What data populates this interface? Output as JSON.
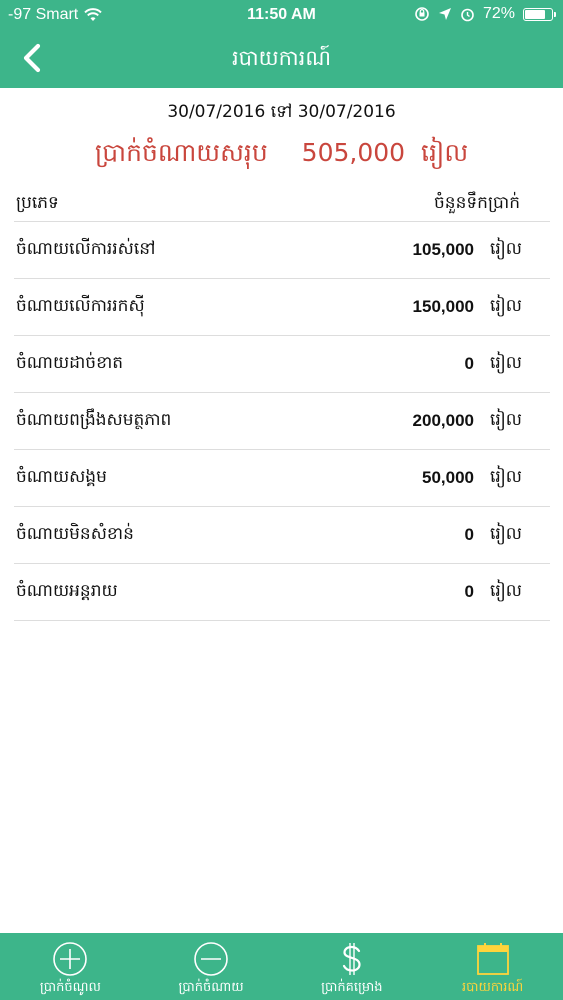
{
  "status_bar": {
    "carrier": "-97 Smart",
    "time": "11:50 AM",
    "battery": "72%",
    "battery_level": 0.72
  },
  "header": {
    "title": "របាយការណ៍"
  },
  "report": {
    "date_from": "30/07/2016",
    "date_separator": "ទៅ",
    "date_to": "30/07/2016",
    "total_label": "ប្រាក់ចំណាយសរុប",
    "total_amount": "505,000",
    "currency": "រៀល"
  },
  "table": {
    "col_category": "ប្រភេទ",
    "col_amount": "ចំនួនទឹកប្រាក់",
    "rows": [
      {
        "name": "ចំណាយលើការរស់នៅ",
        "amount": "105,000",
        "unit": "រៀល"
      },
      {
        "name": "ចំណាយលើការរកស៊ី",
        "amount": "150,000",
        "unit": "រៀល"
      },
      {
        "name": "ចំណាយដាច់ខាត",
        "amount": "0",
        "unit": "រៀល"
      },
      {
        "name": "ចំណាយពង្រឹងសមត្ថភាព",
        "amount": "200,000",
        "unit": "រៀល"
      },
      {
        "name": "ចំណាយសង្គម",
        "amount": "50,000",
        "unit": "រៀល"
      },
      {
        "name": "ចំណាយមិនសំខាន់",
        "amount": "0",
        "unit": "រៀល"
      },
      {
        "name": "ចំណាយអន្តរាយ",
        "amount": "0",
        "unit": "រៀល"
      }
    ]
  },
  "tabs": [
    {
      "label": "ប្រាក់ចំណូល",
      "icon": "plus-circle-icon"
    },
    {
      "label": "ប្រាក់ចំណាយ",
      "icon": "minus-circle-icon"
    },
    {
      "label": "ប្រាក់គម្រោង",
      "icon": "dollar-icon"
    },
    {
      "label": "របាយការណ៍",
      "icon": "calendar-icon",
      "active": true
    }
  ],
  "colors": {
    "primary": "#3db58a",
    "total_text": "#c9463d",
    "active_tab": "#ffd43b"
  }
}
